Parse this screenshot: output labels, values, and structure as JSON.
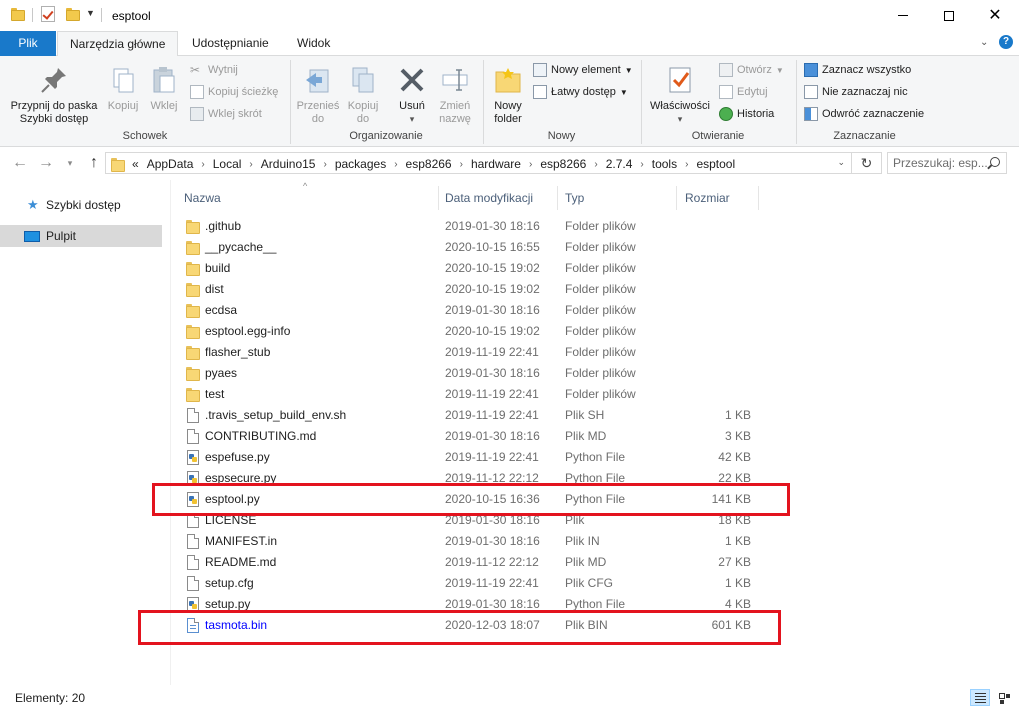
{
  "window": {
    "title": "esptool",
    "controls": {
      "minimize": "—",
      "maximize": "□",
      "close": "✕"
    }
  },
  "ribbon_tabs": [
    {
      "label": "Plik"
    },
    {
      "label": "Narzędzia główne"
    },
    {
      "label": "Udostępnianie"
    },
    {
      "label": "Widok"
    }
  ],
  "ribbon": {
    "schowek": {
      "label": "Schowek",
      "pin": "Przypnij do paska Szybki dostęp",
      "pin_line1": "Przypnij do paska",
      "pin_line2": "Szybki dostęp",
      "copy": "Kopiuj",
      "paste": "Wklej",
      "cut": "Wytnij",
      "copy_path": "Kopiuj ścieżkę",
      "paste_shortcut": "Wklej skrót"
    },
    "organizowanie": {
      "label": "Organizowanie",
      "move_line1": "Przenieś",
      "move_line2": "do",
      "copy_line1": "Kopiuj",
      "copy_line2": "do",
      "delete": "Usuń",
      "rename_line1": "Zmień",
      "rename_line2": "nazwę"
    },
    "nowy": {
      "label": "Nowy",
      "new_folder_line1": "Nowy",
      "new_folder_line2": "folder",
      "new_item": "Nowy element",
      "easy_access": "Łatwy dostęp"
    },
    "otwieranie": {
      "label": "Otwieranie",
      "properties": "Właściwości",
      "open": "Otwórz",
      "edit": "Edytuj",
      "history": "Historia"
    },
    "zaznaczanie": {
      "label": "Zaznaczanie",
      "select_all": "Zaznacz wszystko",
      "select_none": "Nie zaznaczaj nic",
      "invert": "Odwróć zaznaczenie"
    }
  },
  "address": {
    "prefix": "«",
    "crumbs": [
      "AppData",
      "Local",
      "Arduino15",
      "packages",
      "esp8266",
      "hardware",
      "esp8266",
      "2.7.4",
      "tools",
      "esptool"
    ]
  },
  "search": {
    "placeholder": "Przeszukaj: esp..."
  },
  "navpane": {
    "items": [
      {
        "label": "Szybki dostęp"
      },
      {
        "label": "Pulpit"
      }
    ]
  },
  "columns": {
    "name": "Nazwa",
    "date": "Data modyfikacji",
    "type": "Typ",
    "size": "Rozmiar"
  },
  "files": [
    {
      "name": ".github",
      "date": "2019-01-30 18:16",
      "type": "Folder plików",
      "size": "",
      "icon": "folder-icon"
    },
    {
      "name": "__pycache__",
      "date": "2020-10-15 16:55",
      "type": "Folder plików",
      "size": "",
      "icon": "folder-icon"
    },
    {
      "name": "build",
      "date": "2020-10-15 19:02",
      "type": "Folder plików",
      "size": "",
      "icon": "folder-icon"
    },
    {
      "name": "dist",
      "date": "2020-10-15 19:02",
      "type": "Folder plików",
      "size": "",
      "icon": "folder-icon"
    },
    {
      "name": "ecdsa",
      "date": "2019-01-30 18:16",
      "type": "Folder plików",
      "size": "",
      "icon": "folder-icon"
    },
    {
      "name": "esptool.egg-info",
      "date": "2020-10-15 19:02",
      "type": "Folder plików",
      "size": "",
      "icon": "folder-icon"
    },
    {
      "name": "flasher_stub",
      "date": "2019-11-19 22:41",
      "type": "Folder plików",
      "size": "",
      "icon": "folder-icon"
    },
    {
      "name": "pyaes",
      "date": "2019-01-30 18:16",
      "type": "Folder plików",
      "size": "",
      "icon": "folder-icon"
    },
    {
      "name": "test",
      "date": "2019-11-19 22:41",
      "type": "Folder plików",
      "size": "",
      "icon": "folder-icon"
    },
    {
      "name": ".travis_setup_build_env.sh",
      "date": "2019-11-19 22:41",
      "type": "Plik SH",
      "size": "1 KB",
      "icon": "document-icon"
    },
    {
      "name": "CONTRIBUTING.md",
      "date": "2019-01-30 18:16",
      "type": "Plik MD",
      "size": "3 KB",
      "icon": "document-icon"
    },
    {
      "name": "espefuse.py",
      "date": "2019-11-19 22:41",
      "type": "Python File",
      "size": "42 KB",
      "icon": "python-file-icon"
    },
    {
      "name": "espsecure.py",
      "date": "2019-11-12 22:12",
      "type": "Python File",
      "size": "22 KB",
      "icon": "python-file-icon"
    },
    {
      "name": "esptool.py",
      "date": "2020-10-15 16:36",
      "type": "Python File",
      "size": "141 KB",
      "icon": "python-file-icon"
    },
    {
      "name": "LICENSE",
      "date": "2019-01-30 18:16",
      "type": "Plik",
      "size": "18 KB",
      "icon": "document-icon"
    },
    {
      "name": "MANIFEST.in",
      "date": "2019-01-30 18:16",
      "type": "Plik IN",
      "size": "1 KB",
      "icon": "document-icon"
    },
    {
      "name": "README.md",
      "date": "2019-11-12 22:12",
      "type": "Plik MD",
      "size": "27 KB",
      "icon": "document-icon"
    },
    {
      "name": "setup.cfg",
      "date": "2019-11-19 22:41",
      "type": "Plik CFG",
      "size": "1 KB",
      "icon": "document-icon"
    },
    {
      "name": "setup.py",
      "date": "2019-01-30 18:16",
      "type": "Python File",
      "size": "4 KB",
      "icon": "python-file-icon"
    },
    {
      "name": "tasmota.bin",
      "date": "2020-12-03 18:07",
      "type": "Plik BIN",
      "size": "601 KB",
      "icon": "bin-file-icon"
    }
  ],
  "status": {
    "count": "Elementy: 20"
  },
  "colors": {
    "accent": "#1979ca",
    "highlight": "#e3131e",
    "link": "#0000ff",
    "selection": "#d9d9d9"
  }
}
